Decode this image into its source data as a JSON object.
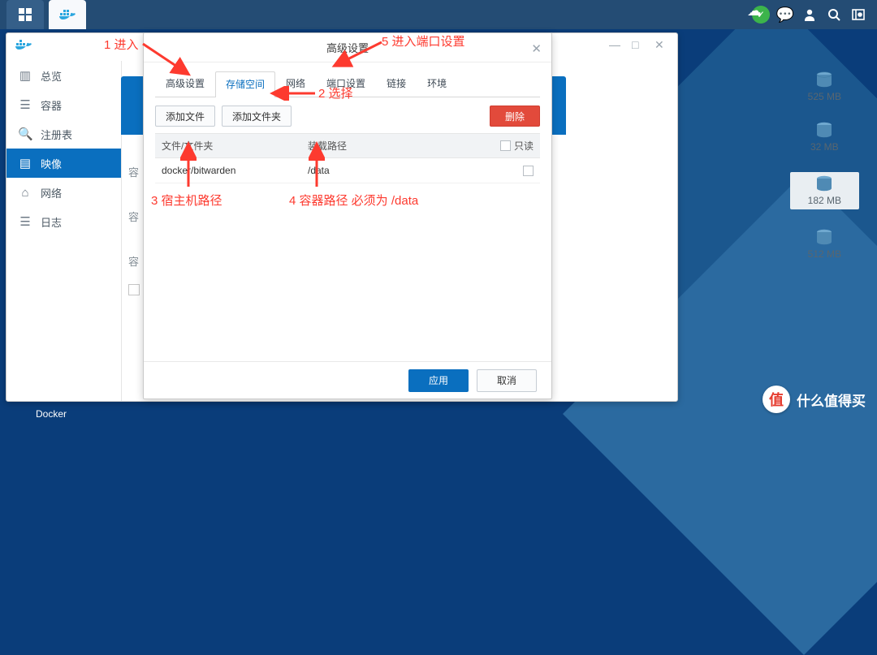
{
  "topbar": {
    "icons": {
      "grid": "grid-icon",
      "docker": "docker-icon",
      "cloud": "cloud-check-icon",
      "chat": "chat-icon",
      "user": "user-icon",
      "search": "search-icon",
      "dashboard": "dashboard-icon"
    }
  },
  "taskbar": {
    "label": "Docker"
  },
  "sidebar": {
    "items": [
      {
        "icon": "overview-icon",
        "label": "总览"
      },
      {
        "icon": "container-icon",
        "label": "容器"
      },
      {
        "icon": "registry-icon",
        "label": "注册表"
      },
      {
        "icon": "image-icon",
        "label": "映像"
      },
      {
        "icon": "network-icon",
        "label": "网络"
      },
      {
        "icon": "log-icon",
        "label": "日志"
      }
    ],
    "active_index": 3
  },
  "sizes": [
    {
      "label": "525 MB"
    },
    {
      "label": "32 MB"
    },
    {
      "label": "182 MB"
    },
    {
      "label": "512 MB"
    }
  ],
  "dialog": {
    "title": "高级设置",
    "tabs": [
      "高级设置",
      "存储空间",
      "网络",
      "端口设置",
      "链接",
      "环境"
    ],
    "active_tab": 1,
    "toolbar": {
      "add_file": "添加文件",
      "add_folder": "添加文件夹",
      "delete": "删除"
    },
    "columns": {
      "path": "文件/文件夹",
      "mount": "装载路径",
      "readonly": "只读"
    },
    "rows": [
      {
        "path": "docker/bitwarden",
        "mount": "/data",
        "readonly": false
      }
    ],
    "footer": {
      "apply": "应用",
      "cancel": "取消"
    }
  },
  "annotations": {
    "a1": "1 进入",
    "a2": "2 选择",
    "a3": "3 宿主机路径",
    "a4": "4 容器路径 必须为 /data",
    "a5": "5 进入端口设置"
  },
  "watermark": {
    "badge": "值",
    "text": "什么值得买"
  }
}
